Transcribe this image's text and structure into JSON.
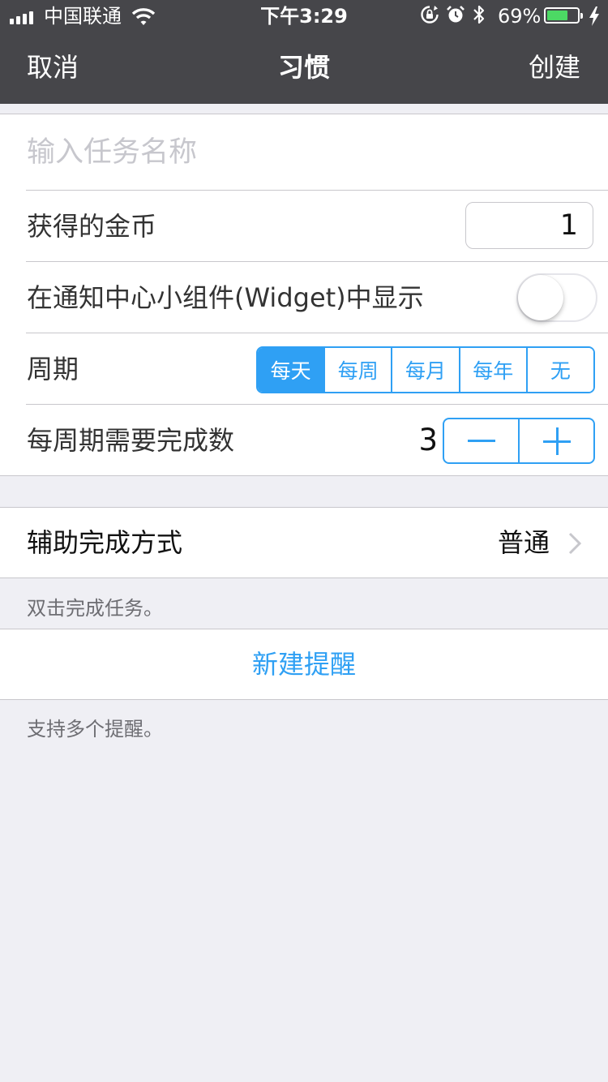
{
  "status_bar": {
    "carrier": "中国联通",
    "time": "下午3:29",
    "battery_percent_text": "69%",
    "battery_level": 0.69,
    "icons": [
      "signal-icon",
      "wifi-icon",
      "rotation-lock-icon",
      "alarm-icon",
      "bluetooth-icon",
      "battery-icon",
      "charging-icon"
    ]
  },
  "nav": {
    "cancel_label": "取消",
    "title": "习惯",
    "create_label": "创建"
  },
  "form": {
    "name_placeholder": "输入任务名称",
    "name_value": "",
    "coins_label": "获得的金币",
    "coins_value": "1",
    "widget_label": "在通知中心小组件(Widget)中显示",
    "widget_enabled": false,
    "period_label": "周期",
    "period_options": [
      "每天",
      "每周",
      "每月",
      "每年",
      "无"
    ],
    "period_selected": "每天",
    "completions_label": "每周期需要完成数",
    "completions_value": "3"
  },
  "assist": {
    "label": "辅助完成方式",
    "value": "普通",
    "footnote": "双击完成任务。"
  },
  "reminder": {
    "button_label": "新建提醒",
    "footnote": "支持多个提醒。"
  },
  "colors": {
    "accent": "#2fa0f4",
    "nav_bg": "#46464a",
    "page_bg": "#efeff4",
    "battery_green": "#4cd964"
  }
}
